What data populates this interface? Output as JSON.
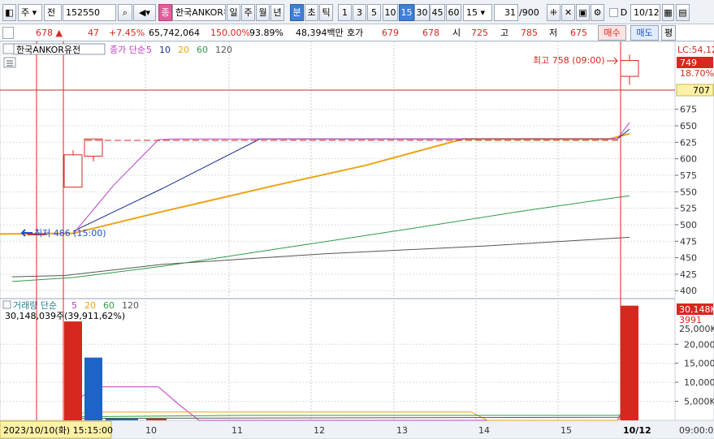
{
  "toolbar": {
    "market": "주",
    "type_label": "전",
    "code": "152550",
    "mode_badge": "종",
    "name": "한국ANKOR유",
    "periods": [
      "일",
      "주",
      "월",
      "년",
      "분",
      "초",
      "틱"
    ],
    "selected_period": "분",
    "intervals": [
      "1",
      "3",
      "5",
      "10",
      "15",
      "30",
      "45",
      "60"
    ],
    "selected_interval": "15",
    "interval_value": "15",
    "count_value": "31",
    "count_total": "/900",
    "date_value": "10/12",
    "date_check_label": "D"
  },
  "quote": {
    "price": "678",
    "change": "47",
    "change_pct": "+7.45%",
    "volume": "65,742,064",
    "vol_ratio": "150.00%",
    "rate2": "93.89%",
    "amount": "48,394백만",
    "bid_label": "호가",
    "bid_value": "679",
    "ask_value": "678",
    "open_label": "시",
    "open_value": "725",
    "high_label": "고",
    "high_value": "785",
    "low_label": "저",
    "low_value": "675",
    "buy_label": "매수",
    "sell_label": "매도",
    "eval_label": "평"
  },
  "colors": {
    "candle_up": "#d6281e",
    "candle_down": "#1d63c8",
    "ma5": "#c23bc2",
    "ma10": "#1a2d8f",
    "ma20": "#eda316",
    "ma60": "#2f9a4a",
    "ma120": "#555555",
    "cursor": "#d6281e"
  },
  "price_panel": {
    "name": "한국ANKOR유전",
    "legend_prefix": "종가 단순",
    "legend_items": [
      {
        "label": "5",
        "color": "#c23bc2"
      },
      {
        "label": "10",
        "color": "#1a2d8f"
      },
      {
        "label": "20",
        "color": "#eda316"
      },
      {
        "label": "60",
        "color": "#2f9a4a"
      },
      {
        "label": "120",
        "color": "#555555"
      }
    ],
    "high_note": "최고 758 (09:00)",
    "low_note": "최저 486 (15:00)",
    "lc_label": "LC:54,12",
    "right_price": "749",
    "right_pct": "18.70%",
    "cursor_price": "707"
  },
  "volume_panel": {
    "legend_prefix": "거래량 단순",
    "legend_items": [
      {
        "label": "5",
        "color": "#c23bc2"
      },
      {
        "label": "20",
        "color": "#eda316"
      },
      {
        "label": "60",
        "color": "#2f9a4a"
      },
      {
        "label": "120",
        "color": "#555555"
      }
    ],
    "value_text": "30,148,039주(39,911,62%)",
    "right_value": "30,148K",
    "right_value2": "3991",
    "axis_label_25": "25,000K"
  },
  "x_axis": {
    "cursor_datetime": "2023/10/10(화) 15:15:00",
    "end_label": "10/12",
    "time_label": "09:00:00"
  },
  "chart_data": {
    "type": "candlestick",
    "price_axis_ticks": [
      675,
      650,
      625,
      600,
      575,
      550,
      525,
      500,
      475,
      450,
      425,
      400
    ],
    "price_ylim": [
      388,
      778
    ],
    "x_labels": [
      "10",
      "11",
      "12",
      "13",
      "14",
      "15",
      "10/12"
    ],
    "candles": [
      {
        "open": 486,
        "high": 486,
        "low": 486,
        "close": 486
      },
      {
        "open": 557,
        "high": 613,
        "low": 557,
        "close": 606
      },
      {
        "open": 604,
        "high": 630,
        "low": 596,
        "close": 630
      },
      {
        "open": 725,
        "high": 758,
        "low": 712,
        "close": 749
      }
    ],
    "volumes": [
      26000,
      16500,
      30148
    ],
    "volume_axis_ticks": [
      20000,
      15000,
      10000,
      5000
    ],
    "volume_ylim": [
      0,
      32000
    ]
  }
}
